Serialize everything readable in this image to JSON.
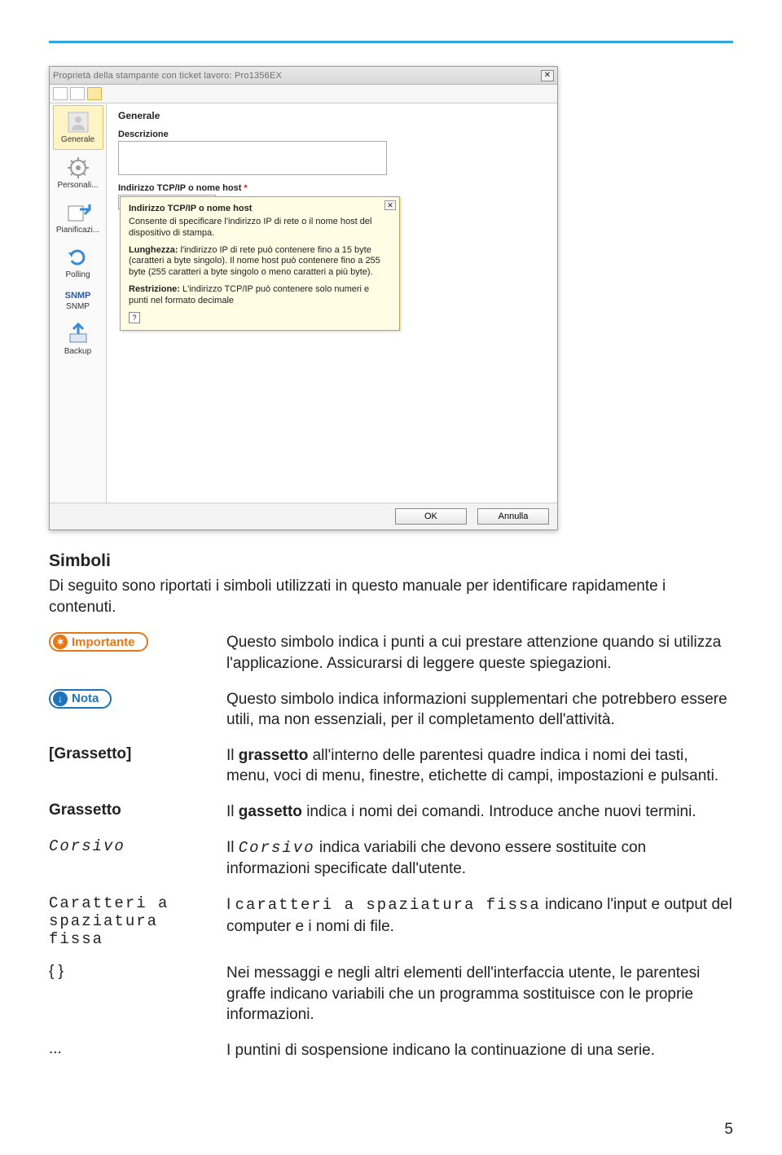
{
  "dialog": {
    "title": "Proprietà della stampante con ticket lavoro: Pro1356EX",
    "sidebar": {
      "items": [
        {
          "label": "Generale"
        },
        {
          "label": "Personali..."
        },
        {
          "label": "Pianificazi..."
        },
        {
          "label": "Polling"
        },
        {
          "label": "SNMP"
        },
        {
          "label": "Backup"
        }
      ]
    },
    "panel": {
      "heading": "Generale",
      "desc_label": "Descrizione",
      "host_label": "Indirizzo TCP/IP o nome host",
      "required_mark": "*"
    },
    "tooltip": {
      "title": "Indirizzo TCP/IP o nome host",
      "p1": "Consente di specificare l'indirizzo IP di rete o il nome host del dispositivo di stampa.",
      "p2_label": "Lunghezza:",
      "p2_body": " l'indirizzo IP di rete può contenere fino a 15 byte (caratteri a byte singolo). Il nome host può contenere fino a 255 byte (255 caratteri a byte singolo o meno caratteri a più byte).",
      "p3_label": "Restrizione:",
      "p3_body": " L'indirizzo TCP/IP può contenere solo numeri e punti nel formato decimale"
    },
    "buttons": {
      "ok": "OK",
      "cancel": "Annulla"
    }
  },
  "section_title": "Simboli",
  "intro": "Di seguito sono riportati i simboli utilizzati in questo manuale per identificare rapidamente i contenuti.",
  "badges": {
    "important": "Importante",
    "nota": "Nota"
  },
  "rows": {
    "important": "Questo simbolo indica i punti a cui prestare attenzione quando si utilizza l'applicazione. Assicurarsi di leggere queste spiegazioni.",
    "nota": "Questo simbolo indica informazioni supplementari che potrebbero essere utili, ma non essenziali, per il completamento dell'attività.",
    "bracket_label": "[Grassetto]",
    "bracket_desc_pre": "Il ",
    "bracket_desc_bold": "grassetto",
    "bracket_desc_post": " all'interno delle parentesi quadre indica i nomi dei tasti, menu, voci di menu, finestre, etichette di campi, impostazioni e pulsanti.",
    "bold_label": "Grassetto",
    "bold_desc_pre": "Il ",
    "bold_desc_bold": "gassetto",
    "bold_desc_post": " indica i nomi dei comandi. Introduce anche nuovi termini.",
    "italic_label": "Corsivo",
    "italic_desc_pre": "Il ",
    "italic_desc_mono": "Corsivo",
    "italic_desc_post": " indica variabili che devono essere sostituite con informazioni specificate dall'utente.",
    "fixed_label": "Caratteri a spaziatura fissa",
    "fixed_desc_pre": "I ",
    "fixed_desc_mono": "caratteri a spaziatura fissa",
    "fixed_desc_post": " indicano l'input e output del computer e i nomi di file.",
    "braces_label": "{ }",
    "braces_desc": "Nei messaggi e negli altri elementi dell'interfaccia utente, le parentesi graffe indicano variabili che un programma sostituisce con le proprie informazioni.",
    "dots_label": "...",
    "dots_desc": "I puntini di sospensione indicano la continuazione di una serie."
  },
  "page_number": "5"
}
